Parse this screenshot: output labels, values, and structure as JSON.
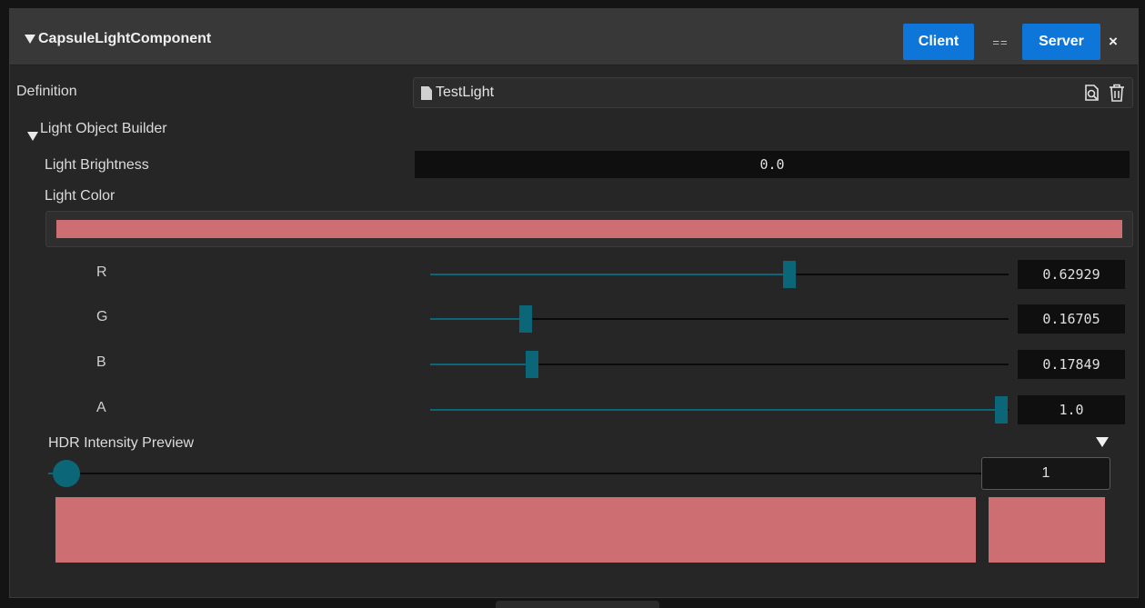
{
  "component": {
    "title": "CapsuleLightComponent",
    "client_label": "Client",
    "eq_label": "==",
    "server_label": "Server",
    "close_label": "×"
  },
  "definition": {
    "label": "Definition",
    "value": "TestLight"
  },
  "builder": {
    "section_label": "Light Object Builder",
    "brightness_label": "Light Brightness",
    "brightness_value": "0.0",
    "color_label": "Light Color",
    "color_hex": "#cd6e73",
    "channels": [
      {
        "label": "R",
        "value": "0.62929",
        "fraction": 0.62929
      },
      {
        "label": "G",
        "value": "0.16705",
        "fraction": 0.16705
      },
      {
        "label": "B",
        "value": "0.17849",
        "fraction": 0.17849
      },
      {
        "label": "A",
        "value": "1.0",
        "fraction": 1.0
      }
    ]
  },
  "hdr": {
    "label": "HDR Intensity Preview",
    "value": "1",
    "slider_fraction": 0.0
  },
  "colors": {
    "accent": "#0e76d9",
    "slider": "#0b6678",
    "swatch": "#cd6e73"
  }
}
